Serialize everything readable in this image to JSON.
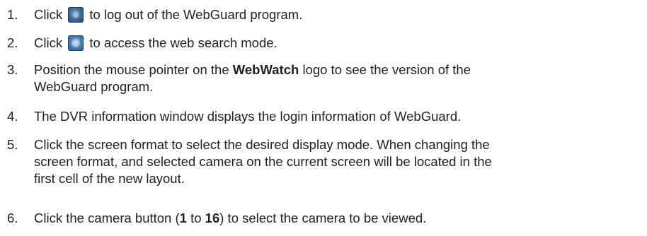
{
  "instructions": [
    {
      "number": "1.",
      "before": "Click",
      "icon": "logout-icon",
      "after": "to log out of the WebGuard program."
    },
    {
      "number": "2.",
      "before": "Click",
      "icon": "search-mode-icon",
      "after": "to access the web search mode."
    },
    {
      "number": "3.",
      "line1_before": "Position the mouse pointer on the",
      "line1_bold": "WebWatch",
      "line1_after": "logo to see the version of the",
      "line2": "WebGuard program."
    },
    {
      "number": "4.",
      "text": "The DVR information window displays the login information of WebGuard."
    },
    {
      "number": "5.",
      "line1": "Click the screen format to select the desired display mode. When changing the",
      "line2": "screen format, and selected camera on the current screen will be located in the",
      "line3": "first cell of the new layout."
    },
    {
      "number": "6.",
      "before": "Click the camera button (",
      "bold1": "1",
      "middle": " to ",
      "bold2": "16",
      "after": ") to select the camera to be viewed."
    }
  ]
}
